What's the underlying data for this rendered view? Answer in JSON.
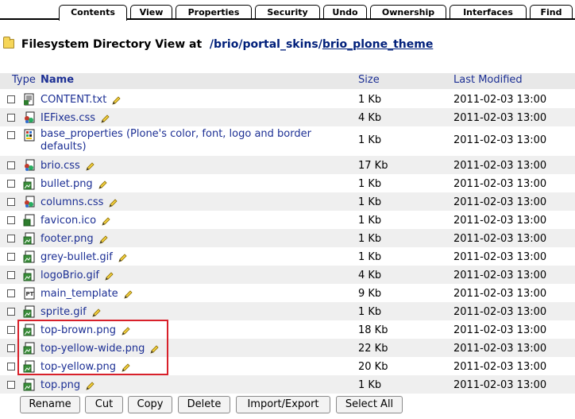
{
  "tabs": [
    {
      "label": "Contents",
      "active": true
    },
    {
      "label": "View"
    },
    {
      "label": "Properties"
    },
    {
      "label": "Security"
    },
    {
      "label": "Undo"
    },
    {
      "label": "Ownership"
    },
    {
      "label": "Interfaces"
    },
    {
      "label": "Find"
    }
  ],
  "header": {
    "prefix": "Filesystem Directory View at",
    "path": [
      "/brio",
      "/portal_skins",
      "/",
      "brio_plone_theme"
    ]
  },
  "columns": {
    "type": "Type",
    "name": "Name",
    "size": "Size",
    "modified": "Last Modified"
  },
  "rows": [
    {
      "name": "CONTENT.txt",
      "icon": "text-file-icon",
      "size": "1 Kb",
      "modified": "2011-02-03 13:00"
    },
    {
      "name": "IEFixes.css",
      "icon": "css-file-icon",
      "size": "4 Kb",
      "modified": "2011-02-03 13:00"
    },
    {
      "name": "base_properties (Plone's color, font, logo and border",
      "name2": "defaults)",
      "icon": "properties-file-icon",
      "size": "1 Kb",
      "modified": "2011-02-03 13:00"
    },
    {
      "name": "brio.css",
      "icon": "css-file-icon",
      "size": "17 Kb",
      "modified": "2011-02-03 13:00"
    },
    {
      "name": "bullet.png",
      "icon": "image-file-icon",
      "size": "1 Kb",
      "modified": "2011-02-03 13:00"
    },
    {
      "name": "columns.css",
      "icon": "css-file-icon",
      "size": "1 Kb",
      "modified": "2011-02-03 13:00"
    },
    {
      "name": "favicon.ico",
      "icon": "file-icon",
      "size": "1 Kb",
      "modified": "2011-02-03 13:00"
    },
    {
      "name": "footer.png",
      "icon": "image-file-icon",
      "size": "1 Kb",
      "modified": "2011-02-03 13:00"
    },
    {
      "name": "grey-bullet.gif",
      "icon": "image-file-icon",
      "size": "1 Kb",
      "modified": "2011-02-03 13:00"
    },
    {
      "name": "logoBrio.gif",
      "icon": "image-file-icon",
      "size": "4 Kb",
      "modified": "2011-02-03 13:00"
    },
    {
      "name": "main_template",
      "icon": "page-template-icon",
      "size": "9 Kb",
      "modified": "2011-02-03 13:00"
    },
    {
      "name": "sprite.gif",
      "icon": "image-file-icon",
      "size": "1 Kb",
      "modified": "2011-02-03 13:00"
    },
    {
      "name": "top-brown.png",
      "icon": "image-file-icon",
      "size": "18 Kb",
      "modified": "2011-02-03 13:00"
    },
    {
      "name": "top-yellow-wide.png",
      "icon": "image-file-icon",
      "size": "22 Kb",
      "modified": "2011-02-03 13:00"
    },
    {
      "name": "top-yellow.png",
      "icon": "image-file-icon",
      "size": "20 Kb",
      "modified": "2011-02-03 13:00"
    },
    {
      "name": "top.png",
      "icon": "image-file-icon",
      "size": "1 Kb",
      "modified": "2011-02-03 13:00"
    }
  ],
  "buttons": [
    "Rename",
    "Cut",
    "Copy",
    "Delete",
    "Import/Export",
    "Select All"
  ]
}
